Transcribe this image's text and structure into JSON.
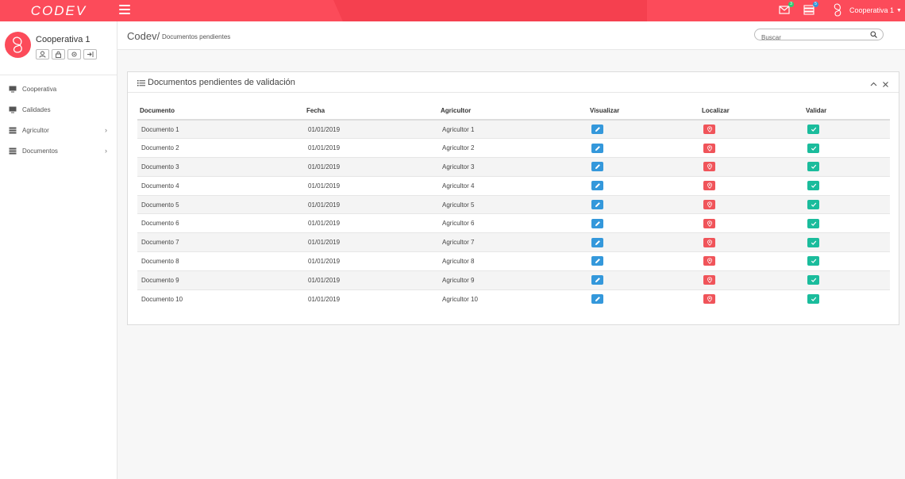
{
  "app": {
    "brand": "CODEV"
  },
  "topbar": {
    "mail_badge": "3",
    "list_badge": "5",
    "user_name": "Cooperativa 1"
  },
  "profile": {
    "name": "Cooperativa 1"
  },
  "sidebar": {
    "items": [
      {
        "label": "Cooperativa"
      },
      {
        "label": "Calidades"
      },
      {
        "label": "Agricultor"
      },
      {
        "label": "Documentos"
      }
    ]
  },
  "header": {
    "root": "Codev/",
    "page": "Documentos pendientes",
    "search_placeholder": "Buscar"
  },
  "panel": {
    "title": "Documentos pendientes de validación",
    "columns": [
      "Documento",
      "Fecha",
      "Agricultor",
      "Visualizar",
      "Localizar",
      "Validar"
    ],
    "rows": [
      {
        "documento": "Documento 1",
        "fecha": "01/01/2019",
        "agricultor": "Agricultor 1"
      },
      {
        "documento": "Documento 2",
        "fecha": "01/01/2019",
        "agricultor": "Agricultor 2"
      },
      {
        "documento": "Documento 3",
        "fecha": "01/01/2019",
        "agricultor": "Agricultor 3"
      },
      {
        "documento": "Documento 4",
        "fecha": "01/01/2019",
        "agricultor": "Agricultor 4"
      },
      {
        "documento": "Documento 5",
        "fecha": "01/01/2019",
        "agricultor": "Agricultor 5"
      },
      {
        "documento": "Documento 6",
        "fecha": "01/01/2019",
        "agricultor": "Agricultor 6"
      },
      {
        "documento": "Documento 7",
        "fecha": "01/01/2019",
        "agricultor": "Agricultor 7"
      },
      {
        "documento": "Documento 8",
        "fecha": "01/01/2019",
        "agricultor": "Agricultor 8"
      },
      {
        "documento": "Documento 9",
        "fecha": "01/01/2019",
        "agricultor": "Agricultor 9"
      },
      {
        "documento": "Documento 10",
        "fecha": "01/01/2019",
        "agricultor": "Agricultor 10"
      }
    ]
  },
  "colors": {
    "brand_red": "#fc4b5a",
    "view_blue": "#3498db",
    "locate_red": "#f0545a",
    "validate_green": "#1abc9c"
  },
  "icons": {
    "view": "pencil-icon",
    "locate": "map-marker-icon",
    "validate": "check-icon"
  }
}
